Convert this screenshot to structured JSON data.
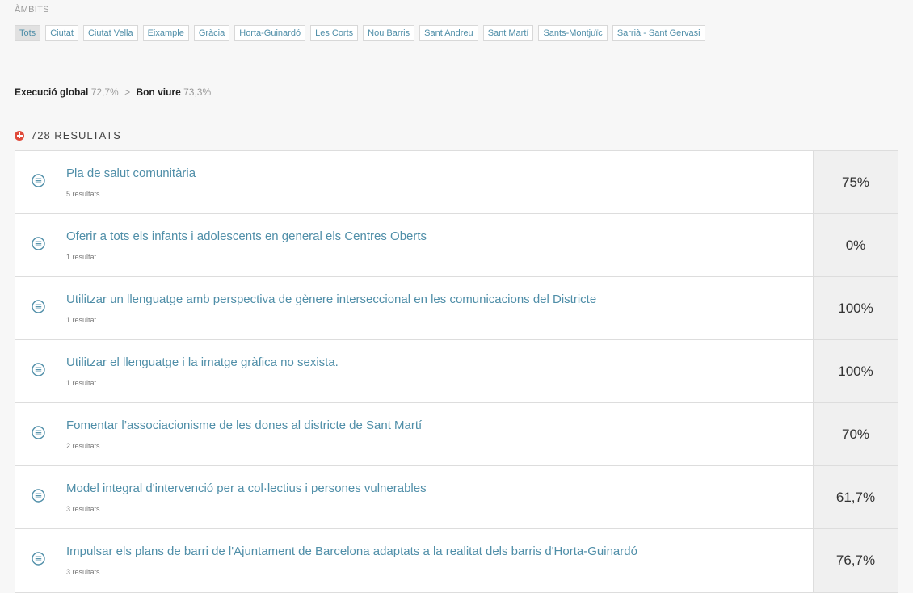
{
  "ambits": {
    "label": "ÀMBITS",
    "filters": [
      "Tots",
      "Ciutat",
      "Ciutat Vella",
      "Eixample",
      "Gràcia",
      "Horta-Guinardó",
      "Les Corts",
      "Nou Barris",
      "Sant Andreu",
      "Sant Martí",
      "Sants-Montjuïc",
      "Sarrià - Sant Gervasi"
    ],
    "active": "Tots"
  },
  "breadcrumb": {
    "global_label": "Execució global",
    "global_pct": "72,7%",
    "separator": ">",
    "section_label": "Bon viure",
    "section_pct": "73,3%"
  },
  "results": {
    "icon": "plus-circle-icon",
    "title": "728 RESULTATS",
    "items": [
      {
        "title": "Pla de salut comunitària",
        "count": "5 resultats",
        "pct": "75%"
      },
      {
        "title": "Oferir a tots els infants i adolescents en general els Centres Oberts",
        "count": "1 resultat",
        "pct": "0%"
      },
      {
        "title": "Utilitzar un llenguatge amb perspectiva de gènere interseccional en les comunicacions del Districte",
        "count": "1 resultat",
        "pct": "100%"
      },
      {
        "title": "Utilitzar el llenguatge i la imatge gràfica no sexista.",
        "count": "1 resultat",
        "pct": "100%"
      },
      {
        "title": "Fomentar l’associacionisme de les dones al districte de Sant Martí",
        "count": "2 resultats",
        "pct": "70%"
      },
      {
        "title": "Model integral d'intervenció per a col·lectius i persones vulnerables",
        "count": "3 resultats",
        "pct": "61,7%"
      },
      {
        "title": "Impulsar els plans de barri de l'Ajuntament de Barcelona adaptats a la realitat dels barris d'Horta-Guinardó",
        "count": "3 resultats",
        "pct": "76,7%"
      }
    ]
  },
  "colors": {
    "link": "#4f8ea8",
    "accent": "#e04a3a",
    "pct_bg": "#f0f0f0"
  }
}
